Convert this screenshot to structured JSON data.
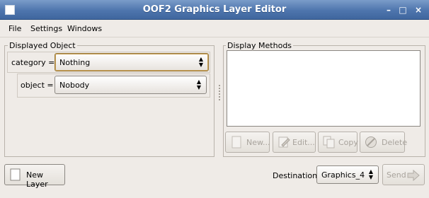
{
  "window": {
    "title": "OOF2 Graphics Layer Editor",
    "minimize_glyph": "–",
    "maximize_glyph": "□",
    "close_glyph": "×"
  },
  "menubar": {
    "items": [
      {
        "label": "File"
      },
      {
        "label": "Settings"
      },
      {
        "label": "Windows"
      }
    ]
  },
  "displayed_object": {
    "frame_label": "Displayed Object",
    "category_label": "category =",
    "category_value": "Nothing",
    "object_label": "object =",
    "object_value": "Nobody"
  },
  "display_methods": {
    "frame_label": "Display Methods",
    "buttons": {
      "new": "New...",
      "edit": "Edit...",
      "copy": "Copy",
      "delete": "Delete"
    }
  },
  "bottom": {
    "new_layer_label": "New Layer",
    "destination_label": "Destination=",
    "destination_value": "Graphics_4",
    "send_label": "Send"
  }
}
